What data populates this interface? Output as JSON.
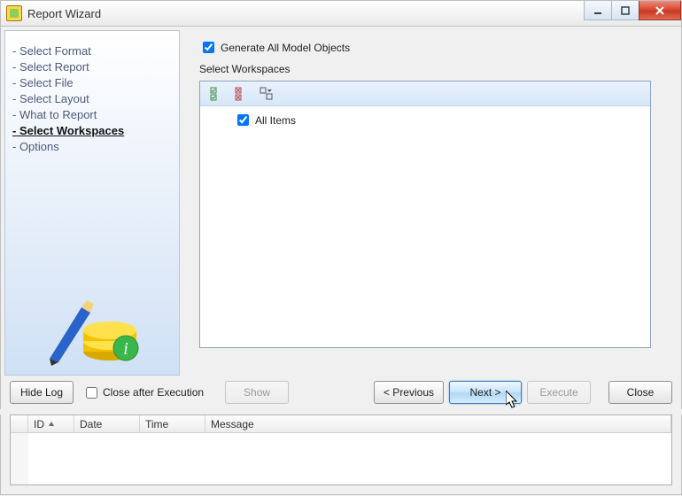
{
  "window": {
    "title": "Report Wizard"
  },
  "steps": [
    {
      "label": "- Select Format"
    },
    {
      "label": "- Select Report"
    },
    {
      "label": "- Select File"
    },
    {
      "label": "- Select Layout"
    },
    {
      "label": "- What to Report"
    },
    {
      "label": "- Select Workspaces",
      "current": true
    },
    {
      "label": "- Options"
    }
  ],
  "content": {
    "generate_all_label": "Generate All Model Objects",
    "generate_all_checked": true,
    "group_label": "Select Workspaces",
    "item_label": "All Items",
    "item_checked": true
  },
  "buttons": {
    "hide_log": "Hide Log",
    "close_after_exec": "Close after Execution",
    "show": "Show",
    "previous": "< Previous",
    "next": "Next >",
    "execute": "Execute",
    "close": "Close"
  },
  "log": {
    "columns": {
      "id": "ID",
      "date": "Date",
      "time": "Time",
      "message": "Message"
    }
  }
}
